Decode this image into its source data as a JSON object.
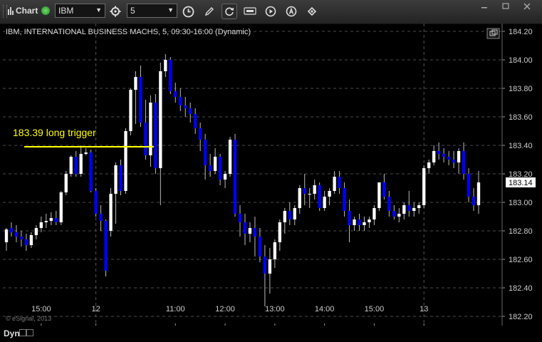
{
  "toolbar": {
    "title": "Chart",
    "symbol_value": "IBM",
    "interval_value": "5",
    "buttons": [
      "gear-icon",
      "clock-icon",
      "pencil-icon",
      "refresh-icon",
      "cursor-icon",
      "play-icon",
      "alert-icon",
      "link-icon"
    ]
  },
  "chart_info": {
    "header": "IBM, INTERNATIONAL BUSINESS MACHS, 5, 09:30-16:00 (Dynamic)",
    "copyright": "© eSignal, 2013",
    "last_price_label": "183.14"
  },
  "annotation": {
    "text": "183.39 long trigger",
    "price": 183.39,
    "color": "#ffff00"
  },
  "bottom": {
    "label": "Dyn"
  },
  "colors": {
    "up": "#ffffff",
    "down": "#0000ff",
    "grid": "#4a4a4a",
    "axis_text": "#cccccc"
  },
  "chart_data": {
    "type": "candlestick",
    "symbol": "IBM",
    "interval": "5",
    "ylim": [
      182.2,
      184.2
    ],
    "y_ticks": [
      "184.20",
      "184.00",
      "183.80",
      "183.60",
      "183.40",
      "183.20",
      "183.00",
      "182.80",
      "182.60",
      "182.40",
      "182.20"
    ],
    "x_ticks": [
      "15:00",
      "12",
      "11:00",
      "12:00",
      "13:00",
      "14:00",
      "15:00",
      "13"
    ],
    "separators": [
      "12",
      "13"
    ],
    "bars": [
      [
        182.72,
        182.82,
        182.66,
        182.81
      ],
      [
        182.82,
        182.86,
        182.76,
        182.79
      ],
      [
        182.79,
        182.84,
        182.72,
        182.76
      ],
      [
        182.76,
        182.8,
        182.69,
        182.74
      ],
      [
        182.74,
        182.78,
        182.66,
        182.7
      ],
      [
        182.7,
        182.79,
        182.68,
        182.77
      ],
      [
        182.77,
        182.84,
        182.74,
        182.82
      ],
      [
        182.82,
        182.9,
        182.79,
        182.86
      ],
      [
        182.86,
        182.92,
        182.82,
        182.87
      ],
      [
        182.87,
        182.93,
        182.84,
        182.89
      ],
      [
        182.89,
        182.94,
        182.84,
        182.86
      ],
      [
        182.86,
        183.08,
        182.84,
        183.07
      ],
      [
        183.07,
        183.22,
        183.05,
        183.2
      ],
      [
        183.2,
        183.33,
        183.18,
        183.32
      ],
      [
        183.32,
        183.36,
        183.18,
        183.2
      ],
      [
        183.2,
        183.4,
        183.18,
        183.34
      ],
      [
        183.34,
        183.38,
        183.33,
        183.35
      ],
      [
        183.35,
        183.37,
        183.07,
        183.08
      ],
      [
        183.08,
        183.1,
        182.9,
        182.92
      ],
      [
        182.92,
        182.98,
        182.8,
        182.87
      ],
      [
        182.87,
        182.88,
        182.48,
        182.52
      ],
      [
        182.8,
        183.1,
        182.76,
        183.06
      ],
      [
        183.06,
        183.28,
        182.85,
        183.26
      ],
      [
        183.26,
        183.3,
        183.05,
        183.08
      ],
      [
        183.08,
        183.52,
        183.06,
        183.5
      ],
      [
        183.5,
        183.8,
        183.47,
        183.79
      ],
      [
        183.79,
        183.92,
        183.55,
        183.88
      ],
      [
        183.88,
        183.96,
        183.53,
        183.56
      ],
      [
        183.56,
        183.72,
        183.3,
        183.33
      ],
      [
        183.33,
        183.75,
        183.25,
        183.7
      ],
      [
        183.7,
        183.76,
        183.2,
        183.24
      ],
      [
        183.24,
        183.98,
        182.98,
        183.92
      ],
      [
        183.92,
        184.04,
        183.88,
        184.0
      ],
      [
        184.0,
        184.02,
        183.76,
        183.78
      ],
      [
        183.78,
        183.84,
        183.7,
        183.74
      ],
      [
        183.74,
        183.8,
        183.64,
        183.68
      ],
      [
        183.68,
        183.74,
        183.6,
        183.66
      ],
      [
        183.66,
        183.7,
        183.56,
        183.62
      ],
      [
        183.62,
        183.66,
        183.48,
        183.52
      ],
      [
        183.52,
        183.56,
        183.36,
        183.44
      ],
      [
        183.44,
        183.48,
        183.16,
        183.26
      ],
      [
        183.26,
        183.34,
        183.18,
        183.22
      ],
      [
        183.22,
        183.38,
        183.2,
        183.32
      ],
      [
        183.32,
        183.34,
        183.12,
        183.16
      ],
      [
        183.16,
        183.22,
        183.1,
        183.2
      ],
      [
        183.2,
        183.46,
        183.18,
        183.44
      ],
      [
        183.44,
        183.48,
        182.9,
        182.92
      ],
      [
        182.92,
        182.98,
        182.76,
        182.86
      ],
      [
        182.86,
        182.92,
        182.7,
        182.78
      ],
      [
        182.78,
        182.86,
        182.72,
        182.82
      ],
      [
        182.82,
        182.9,
        182.62,
        182.76
      ],
      [
        182.76,
        182.82,
        182.58,
        182.62
      ],
      [
        182.62,
        182.7,
        182.27,
        182.5
      ],
      [
        182.5,
        182.68,
        182.36,
        182.6
      ],
      [
        182.6,
        182.74,
        182.54,
        182.72
      ],
      [
        182.72,
        182.88,
        182.66,
        182.86
      ],
      [
        182.86,
        182.96,
        182.78,
        182.94
      ],
      [
        182.94,
        183.0,
        182.84,
        182.88
      ],
      [
        182.88,
        182.98,
        182.84,
        182.96
      ],
      [
        182.96,
        183.12,
        182.92,
        183.1
      ],
      [
        183.1,
        183.2,
        182.98,
        183.06
      ],
      [
        183.06,
        183.1,
        182.96,
        183.06
      ],
      [
        183.06,
        183.16,
        183.02,
        183.12
      ],
      [
        183.12,
        183.14,
        182.94,
        182.96
      ],
      [
        182.96,
        183.08,
        182.94,
        183.04
      ],
      [
        183.04,
        183.1,
        182.98,
        183.08
      ],
      [
        183.08,
        183.22,
        183.06,
        183.18
      ],
      [
        183.18,
        183.22,
        183.06,
        183.1
      ],
      [
        183.1,
        183.14,
        182.9,
        182.94
      ],
      [
        182.94,
        183.02,
        182.72,
        182.84
      ],
      [
        182.84,
        182.9,
        182.8,
        182.88
      ],
      [
        182.88,
        182.92,
        182.8,
        182.84
      ],
      [
        182.84,
        182.9,
        182.8,
        182.86
      ],
      [
        182.86,
        182.9,
        182.82,
        182.88
      ],
      [
        182.88,
        182.98,
        182.84,
        182.96
      ],
      [
        182.96,
        183.12,
        182.94,
        183.14
      ],
      [
        183.14,
        183.2,
        183.02,
        183.04
      ],
      [
        183.04,
        183.08,
        182.9,
        182.94
      ],
      [
        182.94,
        182.98,
        182.88,
        182.9
      ],
      [
        182.9,
        182.96,
        182.86,
        182.92
      ],
      [
        182.92,
        183.0,
        182.88,
        182.98
      ],
      [
        182.98,
        183.08,
        182.9,
        182.94
      ],
      [
        182.94,
        183.0,
        182.9,
        182.96
      ],
      [
        182.96,
        183.0,
        182.92,
        182.98
      ],
      [
        182.98,
        183.26,
        182.96,
        183.24
      ],
      [
        183.24,
        183.3,
        183.2,
        183.28
      ],
      [
        183.28,
        183.4,
        183.26,
        183.36
      ],
      [
        183.36,
        183.42,
        183.3,
        183.34
      ],
      [
        183.34,
        183.38,
        183.28,
        183.32
      ],
      [
        183.32,
        183.36,
        183.26,
        183.3
      ],
      [
        183.3,
        183.36,
        183.24,
        183.28
      ],
      [
        183.28,
        183.38,
        183.2,
        183.36
      ],
      [
        183.36,
        183.42,
        183.16,
        183.2
      ],
      [
        183.2,
        183.24,
        183.0,
        183.04
      ],
      [
        183.04,
        183.1,
        182.94,
        182.98
      ],
      [
        182.98,
        183.22,
        182.92,
        183.14
      ]
    ]
  }
}
